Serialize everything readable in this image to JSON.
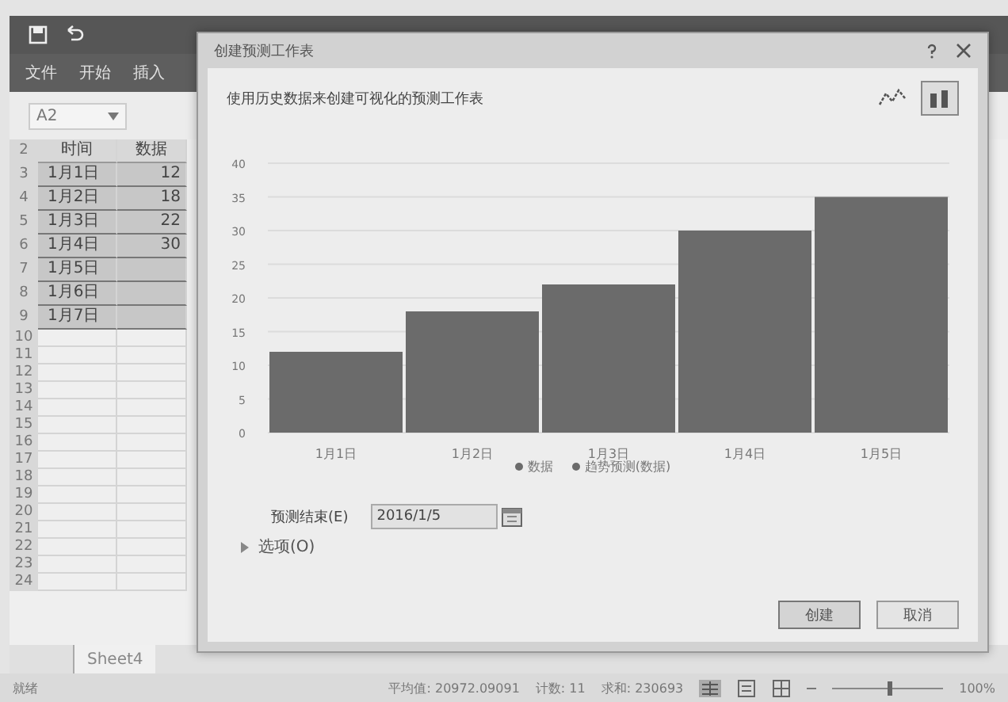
{
  "excel": {
    "ribbon_tabs": [
      {
        "label": "文件",
        "selected": false
      },
      {
        "label": "开始",
        "selected": false
      },
      {
        "label": "插入",
        "selected": false
      }
    ],
    "name_box": "A2",
    "rows": [
      {
        "number": "2",
        "cells": [
          "时间",
          "数据"
        ],
        "selected": false
      },
      {
        "number": "3",
        "cells": [
          "1月1日",
          "12"
        ],
        "selected": true
      },
      {
        "number": "4",
        "cells": [
          "1月2日",
          "18"
        ],
        "selected": true
      },
      {
        "number": "5",
        "cells": [
          "1月3日",
          "22"
        ],
        "selected": true
      },
      {
        "number": "6",
        "cells": [
          "1月4日",
          "30"
        ],
        "selected": true
      },
      {
        "number": "7",
        "cells": [
          "1月5日",
          ""
        ],
        "selected": true
      },
      {
        "number": "8",
        "cells": [
          "1月6日",
          ""
        ],
        "selected": true
      },
      {
        "number": "9",
        "cells": [
          "1月7日",
          ""
        ],
        "selected": true
      }
    ],
    "empty_rows": [
      "10",
      "11",
      "12",
      "13",
      "14",
      "15",
      "16",
      "17",
      "18",
      "19",
      "20",
      "21",
      "22",
      "23",
      "24"
    ],
    "sheet_tab": "Sheet4",
    "status_bar": {
      "ready": "就绪",
      "average": "平均值: 20972.09091",
      "count": "计数: 11",
      "sum": "求和: 230693",
      "zoom": {
        "level": 0.5
      },
      "zoom_label": "100%"
    }
  },
  "dialog": {
    "title": "创建预测工作表",
    "description": "使用历史数据来创建可视化的预测工作表",
    "chart_types": [
      {
        "kind": "line",
        "selected": false
      },
      {
        "kind": "column",
        "selected": true
      }
    ],
    "chart_data": {
      "type": "bar",
      "categories": [
        "1月1日",
        "1月2日",
        "1月3日",
        "1月4日",
        "1月5日"
      ],
      "series": [
        {
          "name": "数据",
          "color": "#6b6b6b",
          "values": [
            12,
            18,
            22,
            30,
            null
          ]
        },
        {
          "name": "趋势预测(数据)",
          "color": "#6b6b6b",
          "values": [
            null,
            null,
            null,
            null,
            35
          ]
        }
      ],
      "ylim": [
        0,
        40
      ],
      "yticks": [
        {
          "value": 0,
          "label": "0"
        },
        {
          "value": 5,
          "label": "5"
        },
        {
          "value": 10,
          "label": "10"
        },
        {
          "value": 15,
          "label": "15"
        },
        {
          "value": 20,
          "label": "20"
        },
        {
          "value": 25,
          "label": "25"
        },
        {
          "value": 30,
          "label": "30"
        },
        {
          "value": 35,
          "label": "35"
        },
        {
          "value": 40,
          "label": "40"
        }
      ],
      "stacked": true,
      "grid": true,
      "legend": true
    },
    "end_label": "预测结束(E)",
    "end_value": "2016/1/5",
    "options": {
      "label": "选项(O)",
      "expanded": false
    },
    "buttons": [
      {
        "label": "创建",
        "kind": "primary"
      },
      {
        "label": "取消",
        "kind": "secondary"
      }
    ]
  }
}
